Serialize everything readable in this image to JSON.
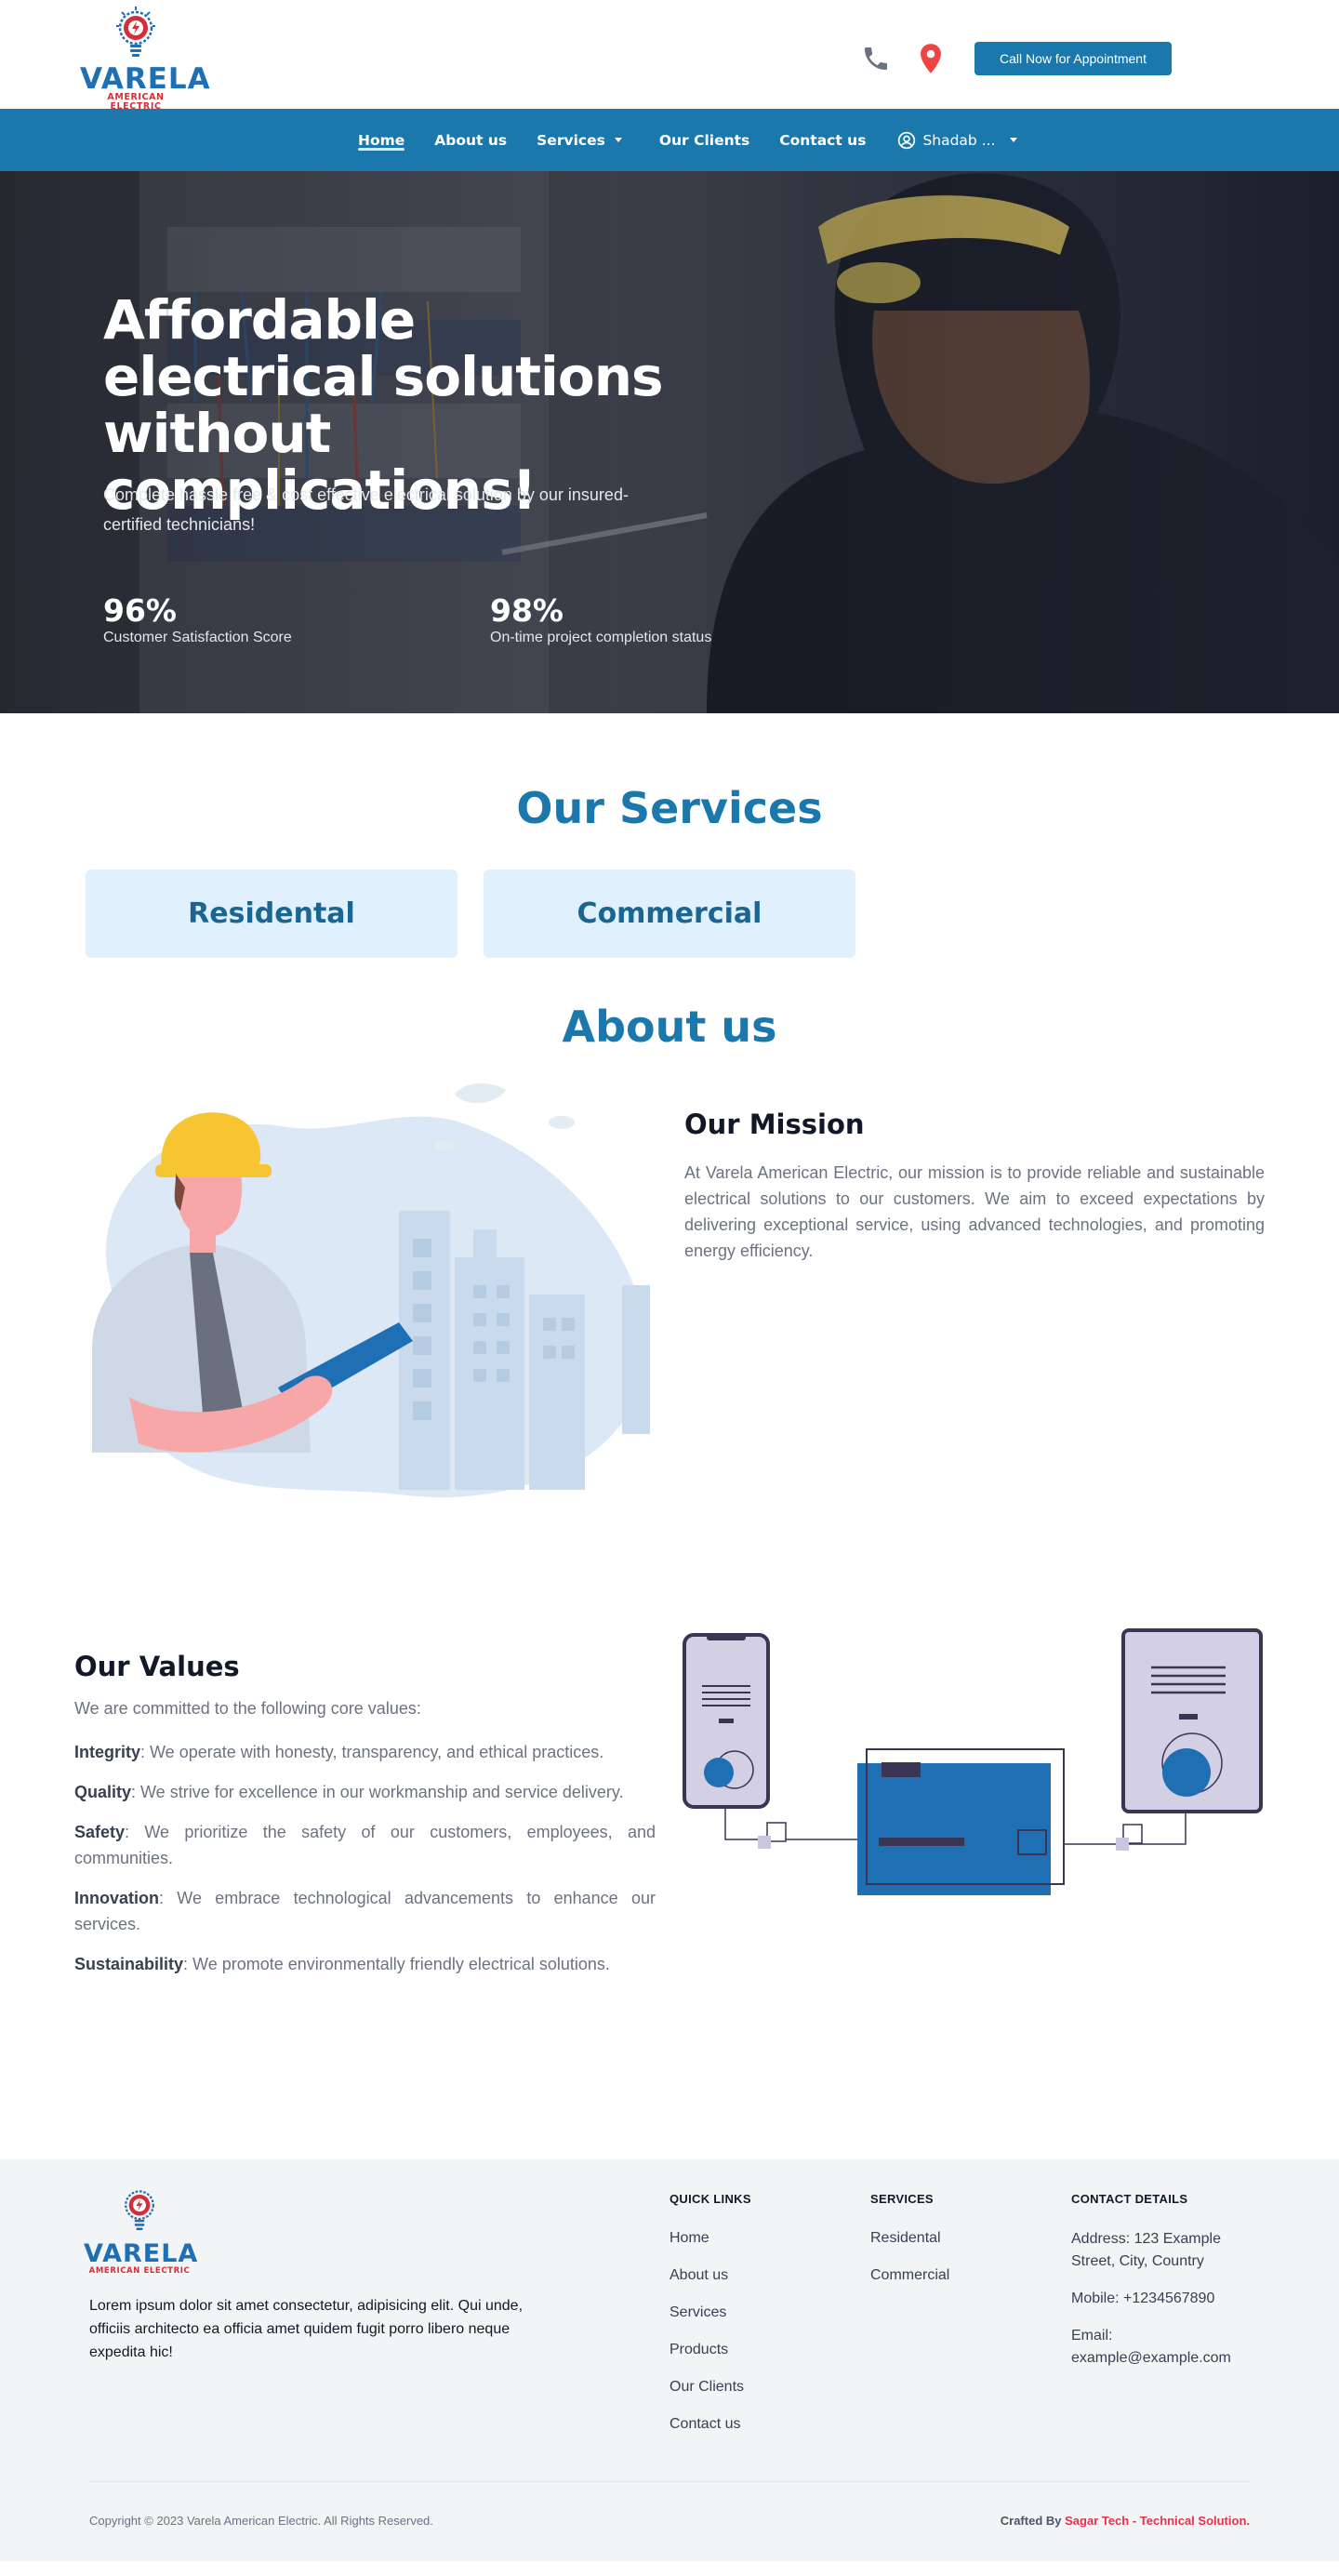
{
  "header": {
    "logo_word": "VARELA",
    "logo_sub": "AMERICAN ELECTRIC",
    "cta_label": "Call Now for Appointment",
    "phone_icon": "phone-icon",
    "location_icon": "map-pin-icon"
  },
  "nav": {
    "items": [
      {
        "label": "Home",
        "active": true
      },
      {
        "label": "About us"
      },
      {
        "label": "Services",
        "has_dropdown": true
      },
      {
        "label": "Our Clients"
      },
      {
        "label": "Contact us"
      }
    ],
    "user_label": "Shadab ...",
    "user_icon": "user-circle-icon"
  },
  "hero": {
    "title": "Affordable electrical solutions without complications!",
    "subtitle": "Complete hassle free & cost effective electrical solution by our insured-certified technicians!",
    "stats": [
      {
        "value": "96%",
        "label": "Customer Satisfaction Score"
      },
      {
        "value": "98%",
        "label": "On-time project completion status"
      }
    ]
  },
  "services": {
    "title": "Our Services",
    "cards": [
      "Residental",
      "Commercial"
    ]
  },
  "about": {
    "title": "About us",
    "mission_title": "Our Mission",
    "mission_text": "At Varela American Electric, our mission is to provide reliable and sustainable electrical solutions to our customers. We aim to exceed expectations by delivering exceptional service, using advanced technologies, and promoting energy efficiency.",
    "values_title": "Our Values",
    "values_intro": "We are committed to the following core values:",
    "values": [
      {
        "name": "Integrity",
        "text": ": We operate with honesty, transparency, and ethical practices."
      },
      {
        "name": "Quality",
        "text": ": We strive for excellence in our workmanship and service delivery."
      },
      {
        "name": "Safety",
        "text": ": We prioritize the safety of our customers, employees, and communities."
      },
      {
        "name": "Innovation",
        "text": ": We embrace technological advancements to enhance our services."
      },
      {
        "name": "Sustainability",
        "text": ": We promote environmentally friendly electrical solutions."
      }
    ]
  },
  "footer": {
    "logo_word": "VARELA",
    "logo_sub": "AMERICAN ELECTRIC",
    "about_text": "Lorem ipsum dolor sit amet consectetur, adipisicing elit. Qui unde, officiis architecto ea officia amet quidem fugit porro libero neque expedita hic!",
    "quick_links_title": "QUICK LINKS",
    "quick_links": [
      "Home",
      "About us",
      "Services",
      "Products",
      "Our Clients",
      "Contact us"
    ],
    "services_title": "SERVICES",
    "services": [
      "Residental",
      "Commercial"
    ],
    "contact_title": "CONTACT DETAILS",
    "address": "Address: 123 Example Street, City, Country",
    "mobile": "Mobile: +1234567890",
    "email": "Email: example@example.com",
    "copyright": "Copyright © 2023 Varela American Electric. All Rights Reserved.",
    "crafted_prefix": "Crafted By ",
    "crafted_link": "Sagar Tech - Technical Solution."
  },
  "colors": {
    "brand_blue": "#1b78ad",
    "logo_red": "#d32f3a",
    "card_bg": "#e0f0fc",
    "crafted_link": "#e0334e"
  }
}
